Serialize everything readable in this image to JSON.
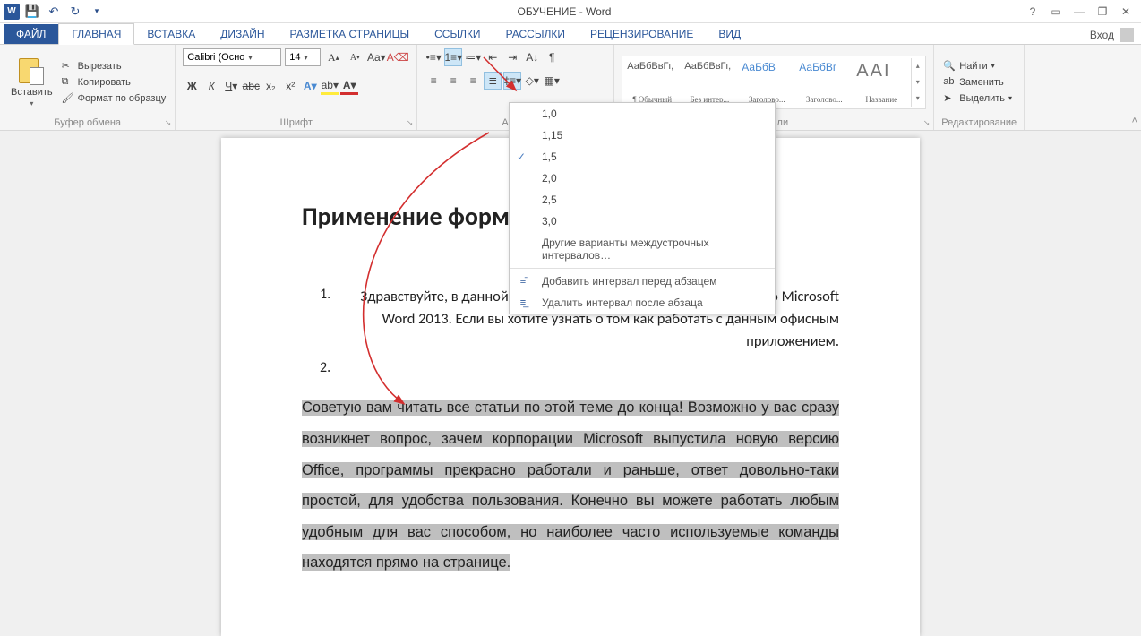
{
  "titlebar": {
    "app_icon_text": "W",
    "title": "ОБУЧЕНИЕ - Word"
  },
  "tabs": {
    "file": "ФАЙЛ",
    "items": [
      "ГЛАВНАЯ",
      "ВСТАВКА",
      "ДИЗАЙН",
      "РАЗМЕТКА СТРАНИЦЫ",
      "ССЫЛКИ",
      "РАССЫЛКИ",
      "РЕЦЕНЗИРОВАНИЕ",
      "ВИД"
    ],
    "login": "Вход"
  },
  "ribbon": {
    "clipboard": {
      "label": "Буфер обмена",
      "paste": "Вставить",
      "cut": "Вырезать",
      "copy": "Копировать",
      "format_painter": "Формат по образцу"
    },
    "font": {
      "label": "Шрифт",
      "name": "Calibri (Осно",
      "size": "14"
    },
    "paragraph": {
      "label": "Абзац"
    },
    "styles": {
      "label": "Стили",
      "items": [
        {
          "preview": "АаБбВвГг,",
          "name": "¶ Обычный",
          "cls": ""
        },
        {
          "preview": "АаБбВвГг,",
          "name": "Без интер...",
          "cls": ""
        },
        {
          "preview": "АаБбВ",
          "name": "Заголово...",
          "cls": "h"
        },
        {
          "preview": "АаБбВг",
          "name": "Заголово...",
          "cls": "h"
        },
        {
          "preview": "ААІ",
          "name": "Название",
          "cls": "title"
        }
      ]
    },
    "editing": {
      "label": "Редактирование",
      "find": "Найти",
      "replace": "Заменить",
      "select": "Выделить"
    }
  },
  "dropdown": {
    "spacings": [
      "1,0",
      "1,15",
      "1,5",
      "2,0",
      "2,5",
      "3,0"
    ],
    "selected_index": 2,
    "more": "Другие варианты междустрочных интервалов…",
    "add_before": "Добавить интервал перед абзацем",
    "remove_after": "Удалить интервал после абзаца"
  },
  "document": {
    "heading": "Применение форматирования",
    "item1_num": "1.",
    "item1_text": "Здравствуйте, в данной статье начинается первая серия уроков по Microsoft Word 2013. Если вы хотите узнать о том как работать с данным офисным приложением.",
    "item2_num": "2.",
    "selected_text": "Советую вам читать все статьи по этой теме до конца! Возможно у вас сразу возникнет вопрос, зачем корпорации Microsoft выпустила новую версию Office, программы прекрасно работали и раньше, ответ довольно-таки простой, для удобства пользования. Конечно вы можете работать любым удобным для вас способом, но наиболее часто используемые команды находятся прямо на странице."
  }
}
